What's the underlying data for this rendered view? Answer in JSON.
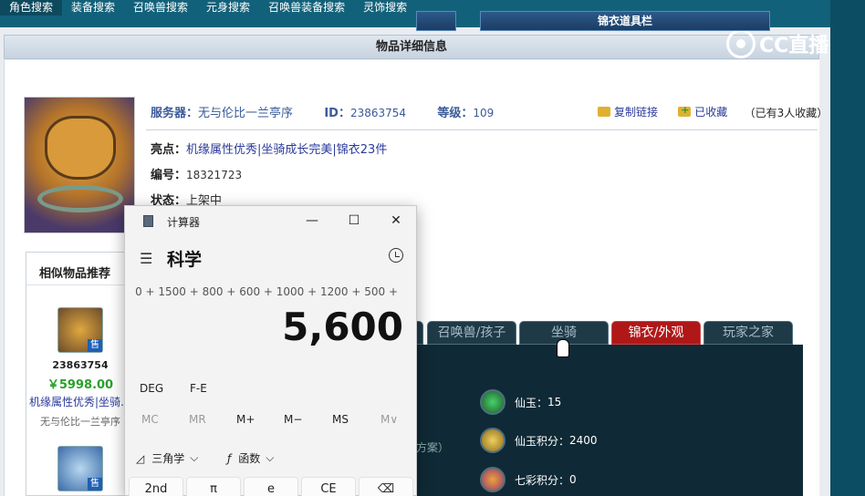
{
  "topnav": [
    "角色搜索",
    "装备搜索",
    "召唤兽搜索",
    "元身搜索",
    "召唤兽装备搜索",
    "灵饰搜索"
  ],
  "header_title": "物品详细信息",
  "watermark": "CC直播",
  "info": {
    "server_label": "服务器：",
    "server_value": "无与伦比一兰亭序",
    "id_label": "ID：",
    "id_value": "23863754",
    "level_label": "等级：",
    "level_value": "109",
    "copy_link": "复制链接",
    "favorited": "已收藏",
    "fav_count": "（已有3人收藏）",
    "highlight_label": "亮点：",
    "highlight_value": "机缘属性优秀|坐骑成长完美|锦衣23件",
    "number_label": "编号：",
    "number_value": "18321723",
    "status_label": "状态：",
    "status_value": "上架中"
  },
  "similar": {
    "title": "相似物品推荐",
    "sale_badge": "售",
    "item": {
      "id": "23863754",
      "price": "￥5998.00",
      "desc": "机缘属性优秀|坐骑…",
      "server": "无与伦比一兰亭序"
    }
  },
  "tabs": [
    "召唤兽/孩子",
    "坐骑",
    "锦衣/外观",
    "玩家之家"
  ],
  "panel": {
    "header": "锦衣道具栏",
    "hint": "方案）",
    "rows": [
      {
        "label": "仙玉：",
        "value": "15"
      },
      {
        "label": "仙玉积分：",
        "value": "2400"
      },
      {
        "label": "七彩积分：",
        "value": "0"
      }
    ]
  },
  "calculator": {
    "window_title": "计算器",
    "mode": "科学",
    "expression": "0 + 1500 + 800 + 600 + 1000 + 1200 + 500 +",
    "result": "5,600",
    "angle": "DEG",
    "fe": "F-E",
    "memory": [
      "MC",
      "MR",
      "M+",
      "M−",
      "MS",
      "M∨"
    ],
    "trig": "三角学",
    "func": "函数",
    "keys": [
      "2nd",
      "π",
      "e",
      "CE",
      "⌫"
    ]
  },
  "colors": {
    "accent_red": "#b01818",
    "price_green": "#2aa02a",
    "link_blue": "#2a3a9a"
  }
}
